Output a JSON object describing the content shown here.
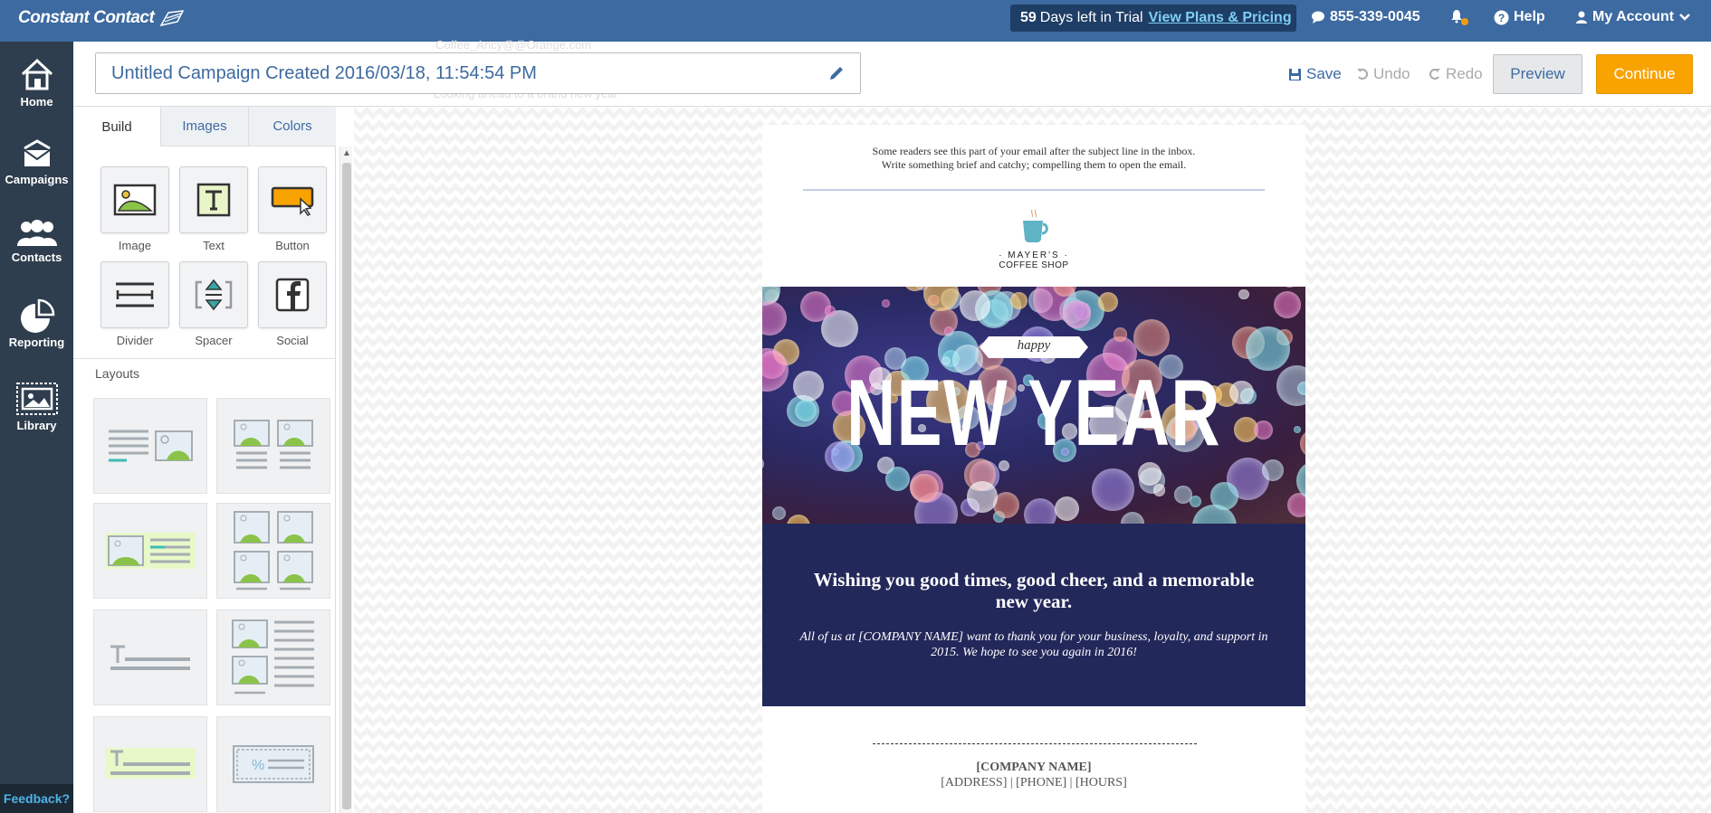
{
  "topbar": {
    "logo_text": "Constant Contact",
    "trial_days": "59",
    "trial_text": "Days left in Trial",
    "trial_link": "View Plans & Pricing",
    "phone": "855-339-0045",
    "help": "Help",
    "account": "My Account"
  },
  "nav": {
    "items": [
      {
        "label": "Home",
        "icon": "home-icon"
      },
      {
        "label": "Campaigns",
        "icon": "campaigns-icon"
      },
      {
        "label": "Contacts",
        "icon": "contacts-icon"
      },
      {
        "label": "Reporting",
        "icon": "reporting-icon"
      },
      {
        "label": "Library",
        "icon": "library-icon"
      }
    ],
    "feedback": "Feedback?"
  },
  "header": {
    "campaign_title": "Untitled Campaign Created 2016/03/18, 11:54:54 PM",
    "ghost_line1": "Coffee_Ancy@@Orange.com",
    "ghost_line2": "Looking ahead to a brand new year",
    "save": "Save",
    "undo": "Undo",
    "redo": "Redo",
    "preview": "Preview",
    "continue": "Continue"
  },
  "panel": {
    "tabs": [
      "Build",
      "Images",
      "Colors"
    ],
    "tools": [
      "Image",
      "Text",
      "Button",
      "Divider",
      "Spacer",
      "Social"
    ],
    "layouts_label": "Layouts"
  },
  "email": {
    "preheader_line1": "Some readers see this part of your email after the subject line in the inbox.",
    "preheader_line2": "Write something brief and catchy; compelling them to open the email.",
    "shop_name_1": "· MAYER'S ·",
    "shop_name_2": "COFFEE SHOP",
    "happy": "happy",
    "new_year": "NEW YEAR",
    "headline": "Wishing you good times, good cheer, and a memorable new year.",
    "body": "All of us at [COMPANY NAME] want to thank you for your business, loyalty, and support in 2015. We hope to see you again in 2016!",
    "company_name": "[COMPANY NAME]",
    "company_info": "[ADDRESS] | [PHONE] | [HOURS]"
  },
  "colors": {
    "topbar": "#3d6aa0",
    "nav": "#2f3e4e",
    "continue": "#f8a300",
    "navy_block": "#23285a",
    "link": "#7fd0f5"
  }
}
